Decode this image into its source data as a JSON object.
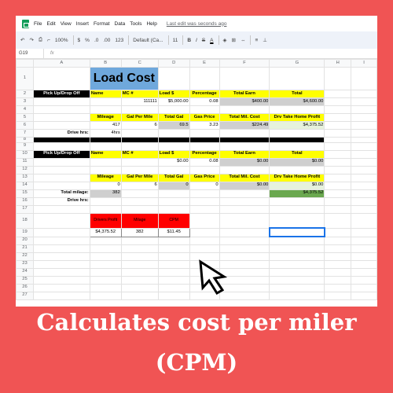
{
  "menu": [
    "File",
    "Edit",
    "View",
    "Insert",
    "Format",
    "Data",
    "Tools",
    "Help"
  ],
  "last_edit": "Last edit was seconds ago",
  "toolbar": {
    "zoom": "100%",
    "currency": "$",
    "percent": "%",
    "dec_less": ".0",
    "dec_more": ".00",
    "number_format": "123",
    "font": "Default (Ca...",
    "font_size": "11",
    "bold": "B",
    "italic": "I",
    "strike": "S",
    "text_color": "A"
  },
  "formula_bar": {
    "cell_ref": "G19",
    "fx": "fx"
  },
  "columns": [
    "A",
    "B",
    "C",
    "D",
    "E",
    "F",
    "G",
    "H",
    "I"
  ],
  "rows": {
    "r1": {
      "title": "Load Cost"
    },
    "r2": {
      "a": "Pick Up/Drop Off",
      "b": "Name",
      "c": "MC #",
      "d": "Load $",
      "e": "Percentage",
      "f": "Total Earn",
      "g": "Total"
    },
    "r3": {
      "c": "111111",
      "d": "$5,000.00",
      "e": "0.08",
      "f": "$400.00",
      "g": "$4,600.00"
    },
    "r5": {
      "b": "Mileage",
      "c": "Gal Per Mile",
      "d": "Total Gal",
      "e": "Gas Price",
      "f": "Total Mil. Cost",
      "g": "Drv Take Home Profit"
    },
    "r6": {
      "b": "417",
      "c": "6",
      "d": "69.5",
      "e": "3.23",
      "f": "$224.49",
      "g": "$4,375.52"
    },
    "r7": {
      "a": "Drive hrs:",
      "b": "4hrs"
    },
    "r10": {
      "a": "Pick Up/Drop Off",
      "b": "Name",
      "c": "MC #",
      "d": "Load $",
      "e": "Percentage",
      "f": "Total Earn",
      "g": "Total"
    },
    "r11": {
      "d": "$0.00",
      "e": "0.08",
      "f": "$0.00",
      "g": "$0.00"
    },
    "r13": {
      "b": "Mileage",
      "c": "Gal Per Mile",
      "d": "Total Gal",
      "e": "Gas Price",
      "f": "Total Mil. Cost",
      "g": "Drv Take Home Profit"
    },
    "r14": {
      "b": "0",
      "c": "6",
      "d": "0",
      "e": "0",
      "f": "$0.00",
      "g": "$0.00"
    },
    "r15": {
      "a": "Total milage:",
      "b": "382",
      "g": "$4,375.52"
    },
    "r16": {
      "a": "Drive hrs:"
    },
    "r18": {
      "b": "Drivers Profit",
      "c": "Milage",
      "d": "CPM"
    },
    "r19": {
      "b": "$4,375.52",
      "c": "382",
      "d": "$11.45"
    }
  },
  "captions": {
    "line1": "Calculates cost per miler",
    "line2": "(CPM)"
  },
  "colors": {
    "background": "#f05454",
    "title_fill": "#6fa8dc",
    "header_fill": "#ffff00",
    "cpm_header_fill": "#ff0000",
    "profit_fill": "#6aa84f",
    "selection": "#1a73e8"
  },
  "icons": [
    "sheets-logo-icon",
    "undo-icon",
    "redo-icon",
    "print-icon",
    "paint-format-icon",
    "cursor-arrow-icon"
  ]
}
